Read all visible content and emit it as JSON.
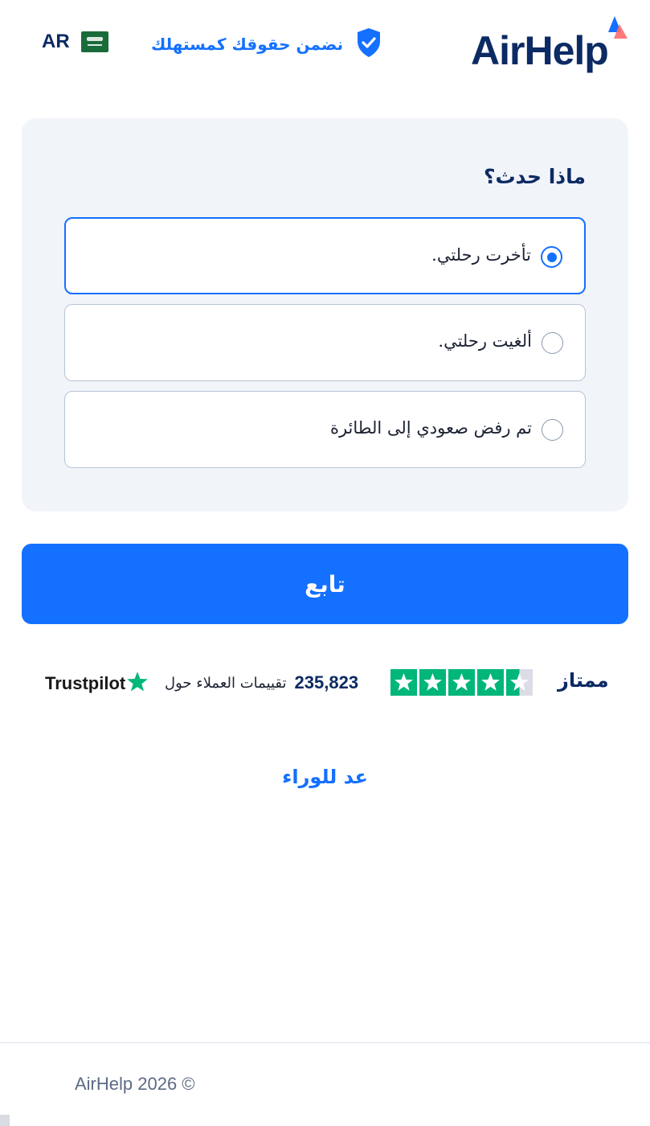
{
  "header": {
    "language_code": "AR",
    "flag_icon": "saudi-arabia-flag-icon",
    "guarantee_text": "نضمن حقوقك كمستهلك",
    "guarantee_icon": "shield-check-icon",
    "logo_text": "AirHelp"
  },
  "question": {
    "title": "ماذا حدث؟",
    "options": [
      {
        "label": "تأخرت رحلتي.",
        "selected": true
      },
      {
        "label": "ألغيت رحلتي.",
        "selected": false
      },
      {
        "label": "تم رفض صعودي إلى الطائرة",
        "selected": false
      }
    ]
  },
  "continue_button": {
    "label": "تابع"
  },
  "trustpilot": {
    "rating_word": "ممتاز",
    "stars": 4.5,
    "review_count": "235,823",
    "review_text": "تقييمات العملاء حول",
    "brand": "Trustpilot"
  },
  "back_link": {
    "label": "عد للوراء"
  },
  "footer": {
    "copyright": "AirHelp 2026 ©"
  },
  "colors": {
    "primary": "#1470ff",
    "navy": "#0c2a63",
    "trustpilot_green": "#00b67a",
    "card_bg": "#f1f4f9"
  }
}
